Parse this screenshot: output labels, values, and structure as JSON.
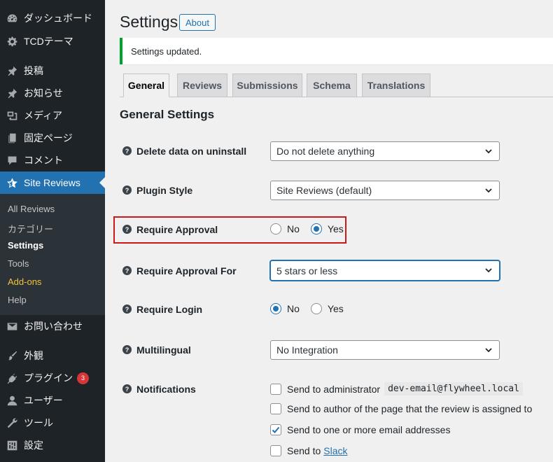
{
  "sidebar": {
    "items": [
      {
        "label": "ダッシュボード",
        "icon": "dashboard-icon"
      },
      {
        "label": "TCDテーマ",
        "icon": "gear-icon"
      },
      {
        "label": "投稿",
        "icon": "pin-icon"
      },
      {
        "label": "お知らせ",
        "icon": "pin-icon"
      },
      {
        "label": "メディア",
        "icon": "media-icon"
      },
      {
        "label": "固定ページ",
        "icon": "page-icon"
      },
      {
        "label": "コメント",
        "icon": "comment-icon"
      },
      {
        "label": "Site Reviews",
        "icon": "star-icon",
        "active": true
      },
      {
        "label": "お問い合わせ",
        "icon": "mail-icon"
      },
      {
        "label": "外観",
        "icon": "brush-icon"
      },
      {
        "label": "プラグイン",
        "icon": "plugin-icon",
        "badge": "3"
      },
      {
        "label": "ユーザー",
        "icon": "user-icon"
      },
      {
        "label": "ツール",
        "icon": "wrench-icon"
      },
      {
        "label": "設定",
        "icon": "settings-icon"
      }
    ],
    "submenu": [
      {
        "label": "All Reviews"
      },
      {
        "label": "カテゴリー"
      },
      {
        "label": "Settings",
        "current": true
      },
      {
        "label": "Tools"
      },
      {
        "label": "Add-ons"
      },
      {
        "label": "Help"
      }
    ]
  },
  "header": {
    "title": "Settings",
    "about_label": "About"
  },
  "notice": {
    "text": "Settings updated.",
    "color": "#00a32a"
  },
  "tabs": [
    {
      "label": "General",
      "active": true
    },
    {
      "label": "Reviews"
    },
    {
      "label": "Submissions"
    },
    {
      "label": "Schema"
    },
    {
      "label": "Translations"
    }
  ],
  "section": {
    "title": "General Settings"
  },
  "settings": {
    "delete_data": {
      "label": "Delete data on uninstall",
      "value": "Do not delete anything"
    },
    "plugin_style": {
      "label": "Plugin Style",
      "value": "Site Reviews (default)"
    },
    "require_approval": {
      "label": "Require Approval",
      "options": [
        "No",
        "Yes"
      ],
      "selected": "Yes"
    },
    "require_approval_for": {
      "label": "Require Approval For",
      "value": "5 stars or less"
    },
    "require_login": {
      "label": "Require Login",
      "options": [
        "No",
        "Yes"
      ],
      "selected": "No"
    },
    "multilingual": {
      "label": "Multilingual",
      "value": "No Integration"
    },
    "notifications": {
      "label": "Notifications",
      "admin_label": "Send to administrator",
      "admin_email": "dev-email@flywheel.local",
      "author_label": "Send to author of the page that the review is assigned to",
      "emails_label": "Send to one or more email addresses",
      "slack_prefix": "Send to",
      "slack_link": "Slack",
      "checked": {
        "admin": false,
        "author": false,
        "emails": true,
        "slack": false
      }
    }
  },
  "colors": {
    "accent": "#2271b1",
    "sidebar_bg": "#1d2327",
    "highlight": "#cc1818",
    "badge": "#d63638"
  }
}
